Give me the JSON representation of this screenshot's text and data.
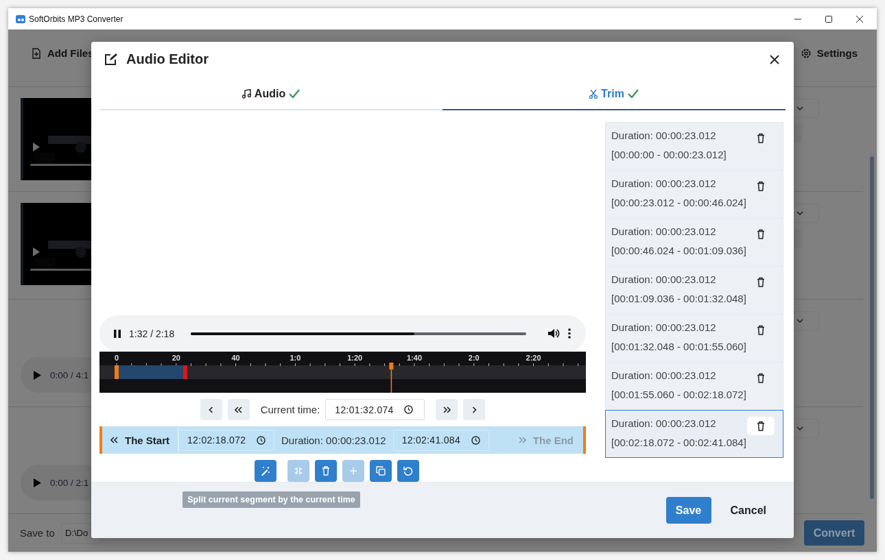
{
  "window": {
    "title": "SoftOrbits MP3 Converter"
  },
  "app": {
    "add_files": "Add Files",
    "settings": "Settings",
    "rows": [
      {
        "kind": "video"
      },
      {
        "kind": "video"
      },
      {
        "kind": "audio",
        "time": "0:00 / 4:1"
      },
      {
        "kind": "audio",
        "time": "0:00 / 2:1"
      }
    ],
    "save_to": {
      "label": "Save to",
      "value": "D:\\Do"
    },
    "convert": "Convert"
  },
  "dialog": {
    "title": "Audio Editor",
    "tabs": [
      {
        "label": "Audio",
        "selected": false
      },
      {
        "label": "Trim",
        "selected": true
      }
    ],
    "player": {
      "time": "1:32 / 2:18",
      "level": 0.667
    },
    "timeline": {
      "ticks": [
        "0",
        "20",
        "40",
        "1:0",
        "1:20",
        "1:40",
        "2:0",
        "2:20"
      ],
      "segment": {
        "level": 0.141
      },
      "playhead": {
        "level": 0.6
      }
    },
    "navigation": {
      "label": "Current time:",
      "value": "12:01:32.074"
    },
    "segment_bar": {
      "start_button": {
        "label": "The Start",
        "disabled": false
      },
      "start": "12:02:18.072",
      "duration": "Duration: 00:00:23.012",
      "end": "12:02:41.084",
      "end_button": {
        "label": "The End",
        "disabled": true
      }
    },
    "tools": [
      {
        "kind": "magic",
        "disabled": false
      },
      {
        "kind": "split",
        "disabled": true
      },
      {
        "kind": "delete",
        "disabled": false
      },
      {
        "kind": "add",
        "disabled": true
      },
      {
        "kind": "copy",
        "disabled": false
      },
      {
        "kind": "reset",
        "disabled": false
      }
    ],
    "tooltip": "Split current segment by the current time",
    "segments": [
      {
        "duration": "Duration: 00:00:23.012",
        "range": "[00:00:00 - 00:00:23.012]",
        "selected": false
      },
      {
        "duration": "Duration: 00:00:23.012",
        "range": "[00:00:23.012 - 00:00:46.024]",
        "selected": false
      },
      {
        "duration": "Duration: 00:00:23.012",
        "range": "[00:00:46.024 - 00:01:09.036]",
        "selected": false
      },
      {
        "duration": "Duration: 00:00:23.012",
        "range": "[00:01:09.036 - 00:01:32.048]",
        "selected": false
      },
      {
        "duration": "Duration: 00:00:23.012",
        "range": "[00:01:32.048 - 00:01:55.060]",
        "selected": false
      },
      {
        "duration": "Duration: 00:00:23.012",
        "range": "[00:01:55.060 - 00:02:18.072]",
        "selected": false
      },
      {
        "duration": "Duration: 00:00:23.012",
        "range": "[00:02:18.072 - 00:02:41.084]",
        "selected": true
      }
    ],
    "save": "Save",
    "cancel": "Cancel"
  }
}
